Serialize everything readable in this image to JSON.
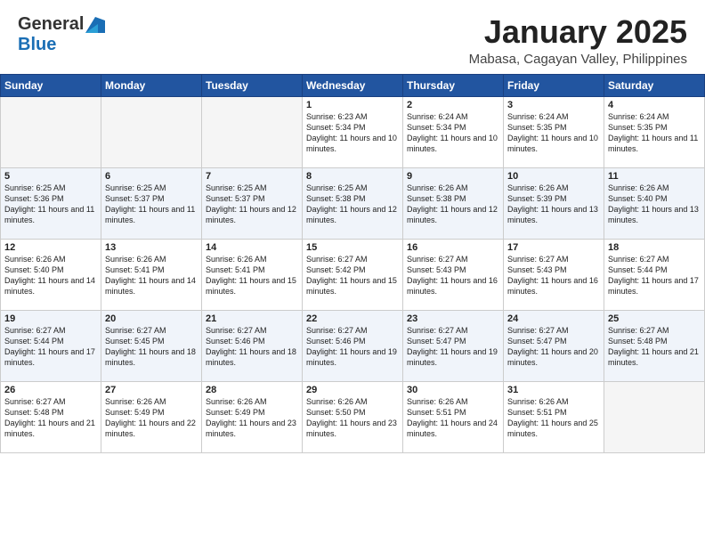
{
  "header": {
    "logo": {
      "general": "General",
      "blue": "Blue"
    },
    "title": "January 2025",
    "subtitle": "Mabasa, Cagayan Valley, Philippines"
  },
  "weekdays": [
    "Sunday",
    "Monday",
    "Tuesday",
    "Wednesday",
    "Thursday",
    "Friday",
    "Saturday"
  ],
  "weeks": [
    [
      {
        "day": "",
        "info": ""
      },
      {
        "day": "",
        "info": ""
      },
      {
        "day": "",
        "info": ""
      },
      {
        "day": "1",
        "info": "Sunrise: 6:23 AM\nSunset: 5:34 PM\nDaylight: 11 hours and 10 minutes."
      },
      {
        "day": "2",
        "info": "Sunrise: 6:24 AM\nSunset: 5:34 PM\nDaylight: 11 hours and 10 minutes."
      },
      {
        "day": "3",
        "info": "Sunrise: 6:24 AM\nSunset: 5:35 PM\nDaylight: 11 hours and 10 minutes."
      },
      {
        "day": "4",
        "info": "Sunrise: 6:24 AM\nSunset: 5:35 PM\nDaylight: 11 hours and 11 minutes."
      }
    ],
    [
      {
        "day": "5",
        "info": "Sunrise: 6:25 AM\nSunset: 5:36 PM\nDaylight: 11 hours and 11 minutes."
      },
      {
        "day": "6",
        "info": "Sunrise: 6:25 AM\nSunset: 5:37 PM\nDaylight: 11 hours and 11 minutes."
      },
      {
        "day": "7",
        "info": "Sunrise: 6:25 AM\nSunset: 5:37 PM\nDaylight: 11 hours and 12 minutes."
      },
      {
        "day": "8",
        "info": "Sunrise: 6:25 AM\nSunset: 5:38 PM\nDaylight: 11 hours and 12 minutes."
      },
      {
        "day": "9",
        "info": "Sunrise: 6:26 AM\nSunset: 5:38 PM\nDaylight: 11 hours and 12 minutes."
      },
      {
        "day": "10",
        "info": "Sunrise: 6:26 AM\nSunset: 5:39 PM\nDaylight: 11 hours and 13 minutes."
      },
      {
        "day": "11",
        "info": "Sunrise: 6:26 AM\nSunset: 5:40 PM\nDaylight: 11 hours and 13 minutes."
      }
    ],
    [
      {
        "day": "12",
        "info": "Sunrise: 6:26 AM\nSunset: 5:40 PM\nDaylight: 11 hours and 14 minutes."
      },
      {
        "day": "13",
        "info": "Sunrise: 6:26 AM\nSunset: 5:41 PM\nDaylight: 11 hours and 14 minutes."
      },
      {
        "day": "14",
        "info": "Sunrise: 6:26 AM\nSunset: 5:41 PM\nDaylight: 11 hours and 15 minutes."
      },
      {
        "day": "15",
        "info": "Sunrise: 6:27 AM\nSunset: 5:42 PM\nDaylight: 11 hours and 15 minutes."
      },
      {
        "day": "16",
        "info": "Sunrise: 6:27 AM\nSunset: 5:43 PM\nDaylight: 11 hours and 16 minutes."
      },
      {
        "day": "17",
        "info": "Sunrise: 6:27 AM\nSunset: 5:43 PM\nDaylight: 11 hours and 16 minutes."
      },
      {
        "day": "18",
        "info": "Sunrise: 6:27 AM\nSunset: 5:44 PM\nDaylight: 11 hours and 17 minutes."
      }
    ],
    [
      {
        "day": "19",
        "info": "Sunrise: 6:27 AM\nSunset: 5:44 PM\nDaylight: 11 hours and 17 minutes."
      },
      {
        "day": "20",
        "info": "Sunrise: 6:27 AM\nSunset: 5:45 PM\nDaylight: 11 hours and 18 minutes."
      },
      {
        "day": "21",
        "info": "Sunrise: 6:27 AM\nSunset: 5:46 PM\nDaylight: 11 hours and 18 minutes."
      },
      {
        "day": "22",
        "info": "Sunrise: 6:27 AM\nSunset: 5:46 PM\nDaylight: 11 hours and 19 minutes."
      },
      {
        "day": "23",
        "info": "Sunrise: 6:27 AM\nSunset: 5:47 PM\nDaylight: 11 hours and 19 minutes."
      },
      {
        "day": "24",
        "info": "Sunrise: 6:27 AM\nSunset: 5:47 PM\nDaylight: 11 hours and 20 minutes."
      },
      {
        "day": "25",
        "info": "Sunrise: 6:27 AM\nSunset: 5:48 PM\nDaylight: 11 hours and 21 minutes."
      }
    ],
    [
      {
        "day": "26",
        "info": "Sunrise: 6:27 AM\nSunset: 5:48 PM\nDaylight: 11 hours and 21 minutes."
      },
      {
        "day": "27",
        "info": "Sunrise: 6:26 AM\nSunset: 5:49 PM\nDaylight: 11 hours and 22 minutes."
      },
      {
        "day": "28",
        "info": "Sunrise: 6:26 AM\nSunset: 5:49 PM\nDaylight: 11 hours and 23 minutes."
      },
      {
        "day": "29",
        "info": "Sunrise: 6:26 AM\nSunset: 5:50 PM\nDaylight: 11 hours and 23 minutes."
      },
      {
        "day": "30",
        "info": "Sunrise: 6:26 AM\nSunset: 5:51 PM\nDaylight: 11 hours and 24 minutes."
      },
      {
        "day": "31",
        "info": "Sunrise: 6:26 AM\nSunset: 5:51 PM\nDaylight: 11 hours and 25 minutes."
      },
      {
        "day": "",
        "info": ""
      }
    ]
  ]
}
